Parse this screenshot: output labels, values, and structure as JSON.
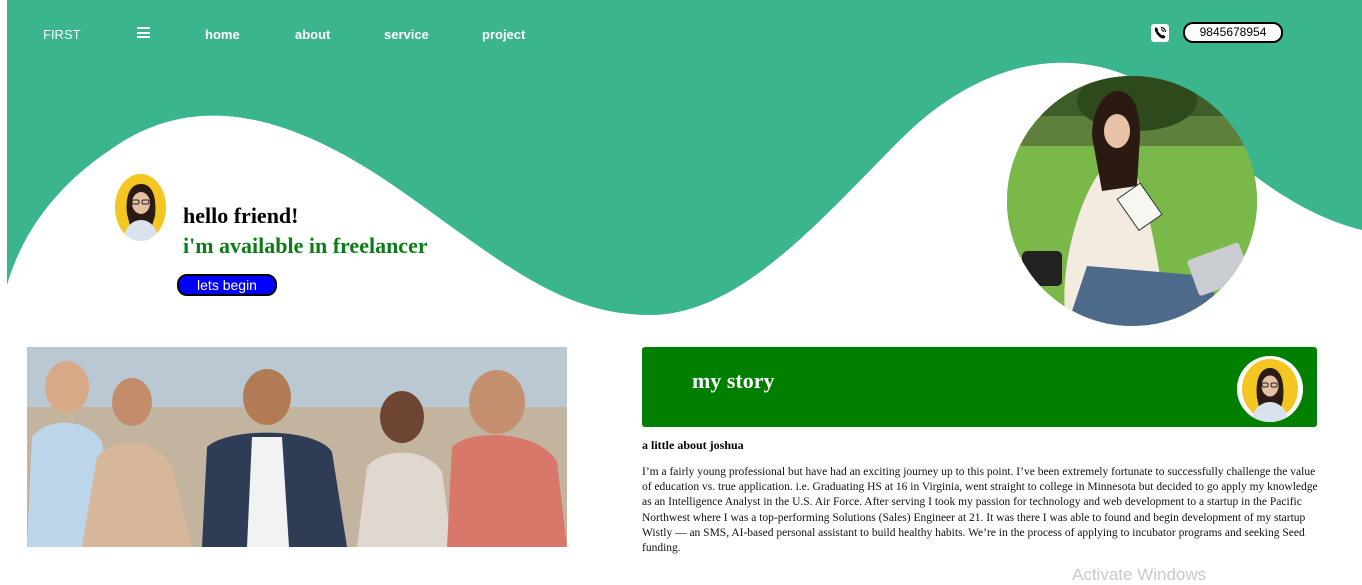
{
  "colors": {
    "brand_green": "#3bb58e",
    "story_green": "#007f00",
    "button_blue": "#0000ff",
    "accent_text_green": "#0b7d17"
  },
  "nav": {
    "brand": "FIRST",
    "menu_icon": "hamburger-icon",
    "links": [
      "home",
      "about",
      "service",
      "project"
    ],
    "phone_icon": "phone-icon",
    "phone": "9845678954"
  },
  "hero": {
    "greeting": "hello friend!",
    "tagline": "i'm available in freelancer",
    "cta": "lets begin"
  },
  "story": {
    "title": "my story",
    "subtitle": "a little about joshua",
    "body": "I’m a fairly young professional but have had an exciting journey up to this point. I’ve been extremely fortunate to successfully challenge the value of education vs. true application. i.e. Graduating HS at 16 in Virginia, went straight to college in Minnesota but decided to go apply my knowledge as an Intelligence Analyst in the U.S. Air Force. After serving I took my passion for technology and web development to a startup in the Pacific Northwest where I was a top-performing Solutions (Sales) Engineer at 21. It was there I was able to found and begin development of my startup Wistly — an SMS, AI-based personal assistant to build healthy habits. We’re in the process of applying to incubator programs and seeking Seed funding."
  },
  "overlay": {
    "watermark": "Activate Windows"
  }
}
